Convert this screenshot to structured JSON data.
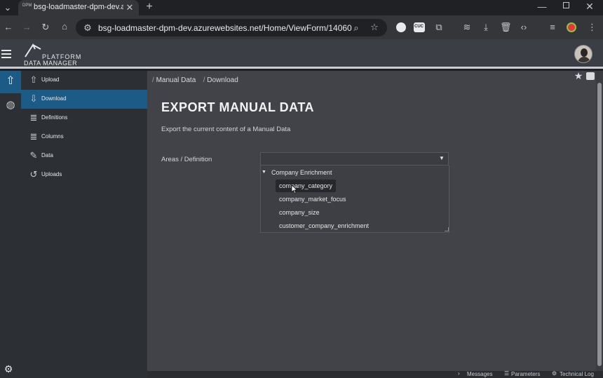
{
  "browser": {
    "tab_title": "bsg-loadmaster-dpm-dev.azure",
    "tab_favicon_text": "DPM",
    "url": "bsg-loadmaster-dpm-dev.azurewebsites.net/Home/ViewForm/14060",
    "extension_label": "CUC"
  },
  "app": {
    "logo_line1": "PLATFORM",
    "logo_line2": "DATA MANAGER"
  },
  "sidebar": {
    "items": [
      {
        "label": "Upload"
      },
      {
        "label": "Download"
      },
      {
        "label": "Definitions"
      },
      {
        "label": "Columns"
      },
      {
        "label": "Data"
      },
      {
        "label": "Uploads"
      }
    ]
  },
  "breadcrumb": {
    "item1": "Manual Data",
    "item2": "Download"
  },
  "main": {
    "title": "EXPORT MANUAL DATA",
    "subtitle": "Export the current content of a Manual Data",
    "field_label": "Areas / Definition"
  },
  "dropdown": {
    "group": "Company Enrichment",
    "options": [
      "company_category",
      "company_market_focus",
      "company_size",
      "customer_company_enrichment"
    ]
  },
  "statusbar": {
    "messages": "Messages",
    "parameters": "Parameters",
    "technical_log": "Technical Log"
  },
  "colors": {
    "active_nav": "#1d5b87",
    "background": "#414349",
    "sidebar": "#2c3035"
  }
}
